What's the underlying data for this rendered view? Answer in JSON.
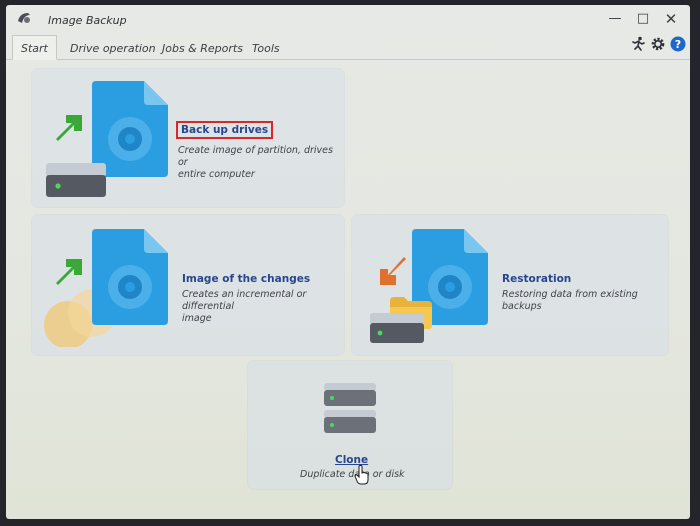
{
  "window": {
    "title": "Image Backup"
  },
  "tabs": [
    {
      "label": "Start"
    },
    {
      "label": "Drive operation"
    },
    {
      "label": "Jobs & Reports"
    },
    {
      "label": "Tools"
    }
  ],
  "tiles": {
    "backup": {
      "title": "Back up drives",
      "desc1": "Create image of partition, drives or",
      "desc2": "entire computer"
    },
    "changes": {
      "title": "Image of the changes",
      "desc1": "Creates an incremental or differential",
      "desc2": "image"
    },
    "restore": {
      "title": "Restoration",
      "desc1": "Restoring data from existing backups"
    },
    "clone": {
      "title": "Clone",
      "desc1": "Duplicate data or disk"
    }
  },
  "header_icons": [
    "run-icon",
    "settings-icon",
    "help-icon"
  ],
  "colors": {
    "accent": "#27468f",
    "highlight": "#d9272e",
    "green_arrow": "#3aa836",
    "orange_arrow": "#e0702e",
    "doc_blue": "#2a9ee0"
  }
}
